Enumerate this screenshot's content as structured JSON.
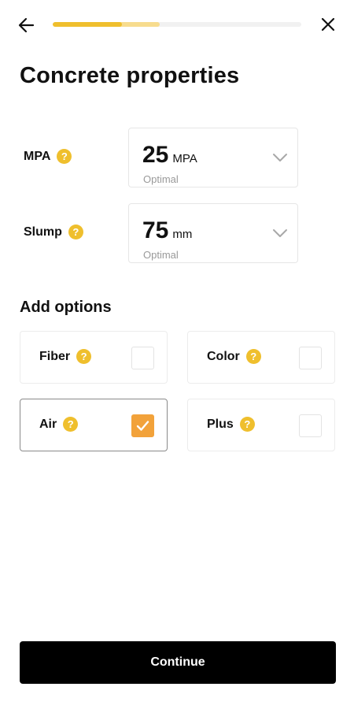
{
  "header": {
    "back_icon": "arrow-left-icon",
    "close_icon": "close-icon",
    "progress": {
      "filled_fraction": 0.28,
      "buffer_fraction": 0.43,
      "fill_color": "#efbf2d",
      "buffer_color": "#f7dc8e"
    }
  },
  "title": "Concrete properties",
  "properties": {
    "mpa": {
      "label": "MPA",
      "help": "?",
      "value": "25",
      "unit": "MPA",
      "hint": "Optimal"
    },
    "slump": {
      "label": "Slump",
      "help": "?",
      "value": "75",
      "unit": "mm",
      "hint": "Optimal"
    }
  },
  "options": {
    "title": "Add options",
    "items": [
      {
        "label": "Fiber",
        "help": "?",
        "checked": false
      },
      {
        "label": "Color",
        "help": "?",
        "checked": false
      },
      {
        "label": "Air",
        "help": "?",
        "checked": true
      },
      {
        "label": "Plus",
        "help": "?",
        "checked": false
      }
    ]
  },
  "footer": {
    "continue_label": "Continue"
  },
  "colors": {
    "accent": "#efbf2d",
    "checked": "#f2a23a",
    "button": "#000000"
  }
}
